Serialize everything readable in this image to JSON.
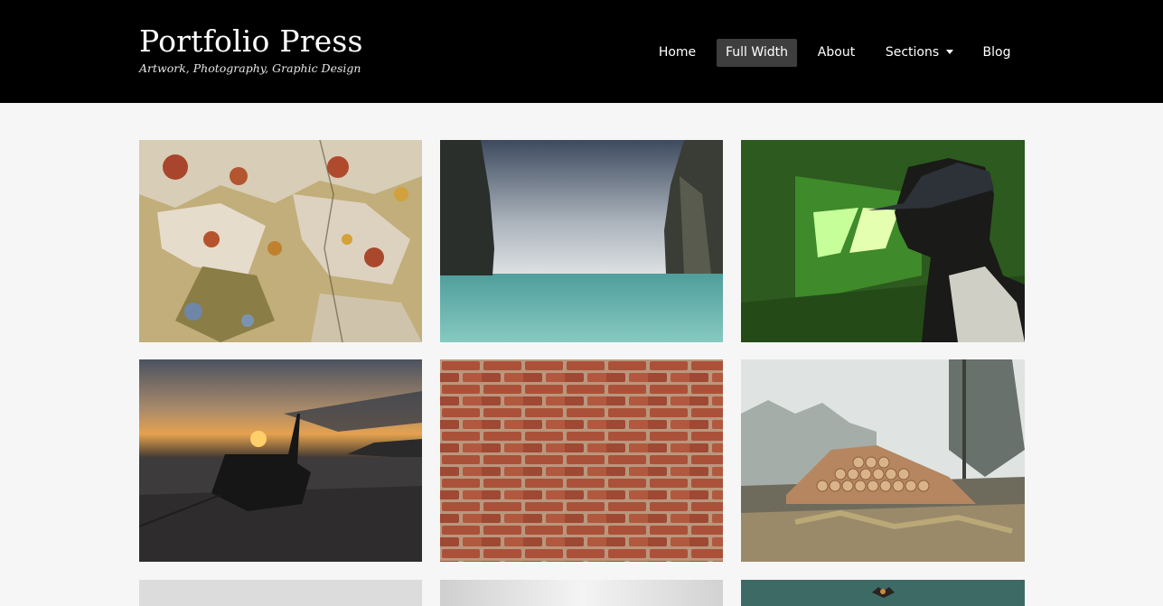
{
  "site": {
    "title": "Portfolio Press",
    "tagline": "Artwork, Photography, Graphic Design"
  },
  "nav": {
    "items": [
      {
        "label": "Home",
        "active": false
      },
      {
        "label": "Full Width",
        "active": true
      },
      {
        "label": "About",
        "active": false
      },
      {
        "label": "Sections",
        "active": false,
        "has_dropdown": true
      },
      {
        "label": "Blog",
        "active": false
      }
    ]
  },
  "colors": {
    "header_bg": "#000000",
    "page_bg": "#f6f6f6",
    "active_nav_bg": "#3e3e3e"
  },
  "portfolio": {
    "tiles": [
      {
        "subject": "peeling-paint-wall"
      },
      {
        "subject": "sea-cliffs"
      },
      {
        "subject": "green-light-room-person-in-cap"
      },
      {
        "subject": "longtail-boat-sunset"
      },
      {
        "subject": "brick-wall"
      },
      {
        "subject": "stacked-logs-foggy-forest"
      },
      {
        "subject": "light-gray-image"
      },
      {
        "subject": "light-gradient-image"
      },
      {
        "subject": "teal-sky-with-bird"
      }
    ]
  }
}
